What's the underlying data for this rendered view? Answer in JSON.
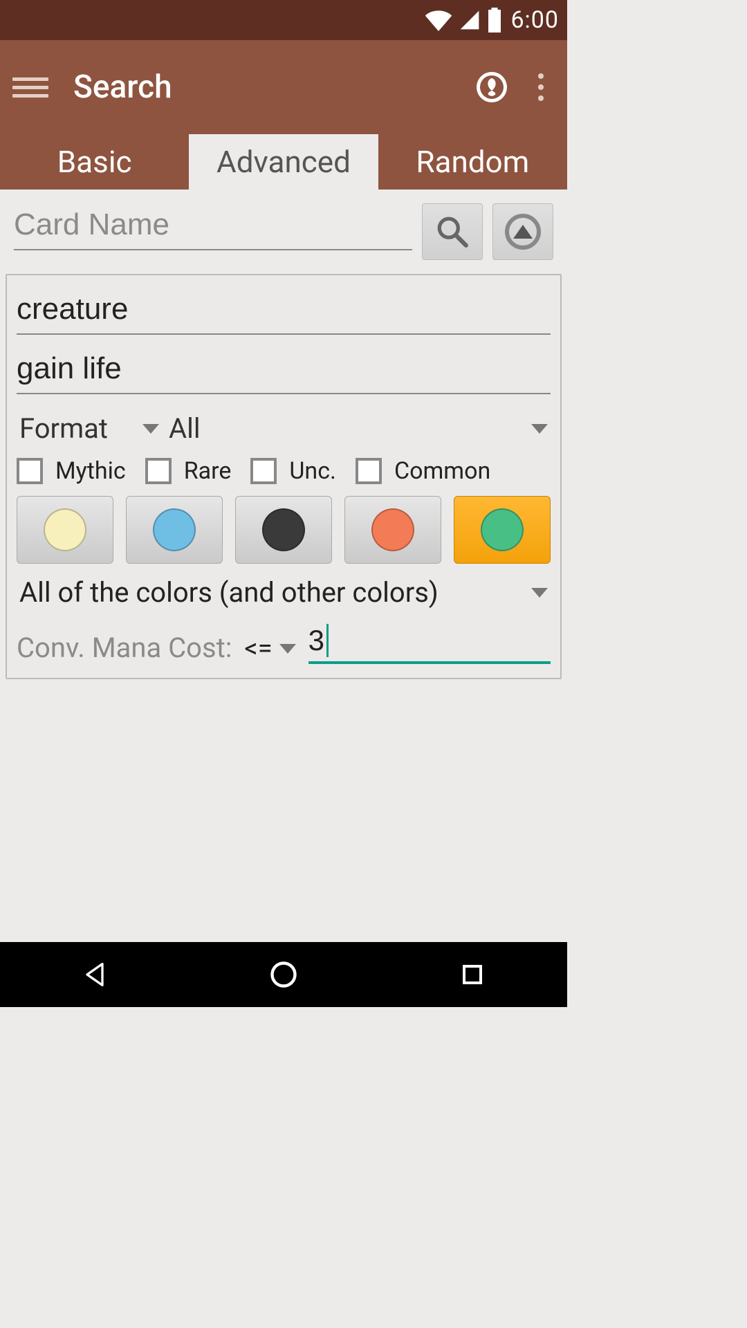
{
  "statusbar": {
    "time": "6:00"
  },
  "appbar": {
    "title": "Search"
  },
  "tabs": {
    "basic": "Basic",
    "advanced": "Advanced",
    "random": "Random",
    "active": "advanced"
  },
  "search": {
    "card_name_placeholder": "Card Name",
    "card_name_value": ""
  },
  "panel": {
    "type_value": "creature",
    "text_value": "gain life",
    "format_label": "Format",
    "format_value": "All",
    "rarities": {
      "mythic": "Mythic",
      "rare": "Rare",
      "uncommon": "Unc.",
      "common": "Common"
    },
    "colors": [
      {
        "name": "white",
        "hex": "#F7F0BD",
        "active": false
      },
      {
        "name": "blue",
        "hex": "#6FBEE4",
        "active": false
      },
      {
        "name": "black",
        "hex": "#3A3A3A",
        "active": false
      },
      {
        "name": "red",
        "hex": "#F37B56",
        "active": false
      },
      {
        "name": "green",
        "hex": "#48BF84",
        "active": true
      }
    ],
    "color_mode": "All of the colors (and other colors)",
    "cmc_label": "Conv. Mana Cost:",
    "cmc_op": "<=",
    "cmc_value": "3"
  }
}
